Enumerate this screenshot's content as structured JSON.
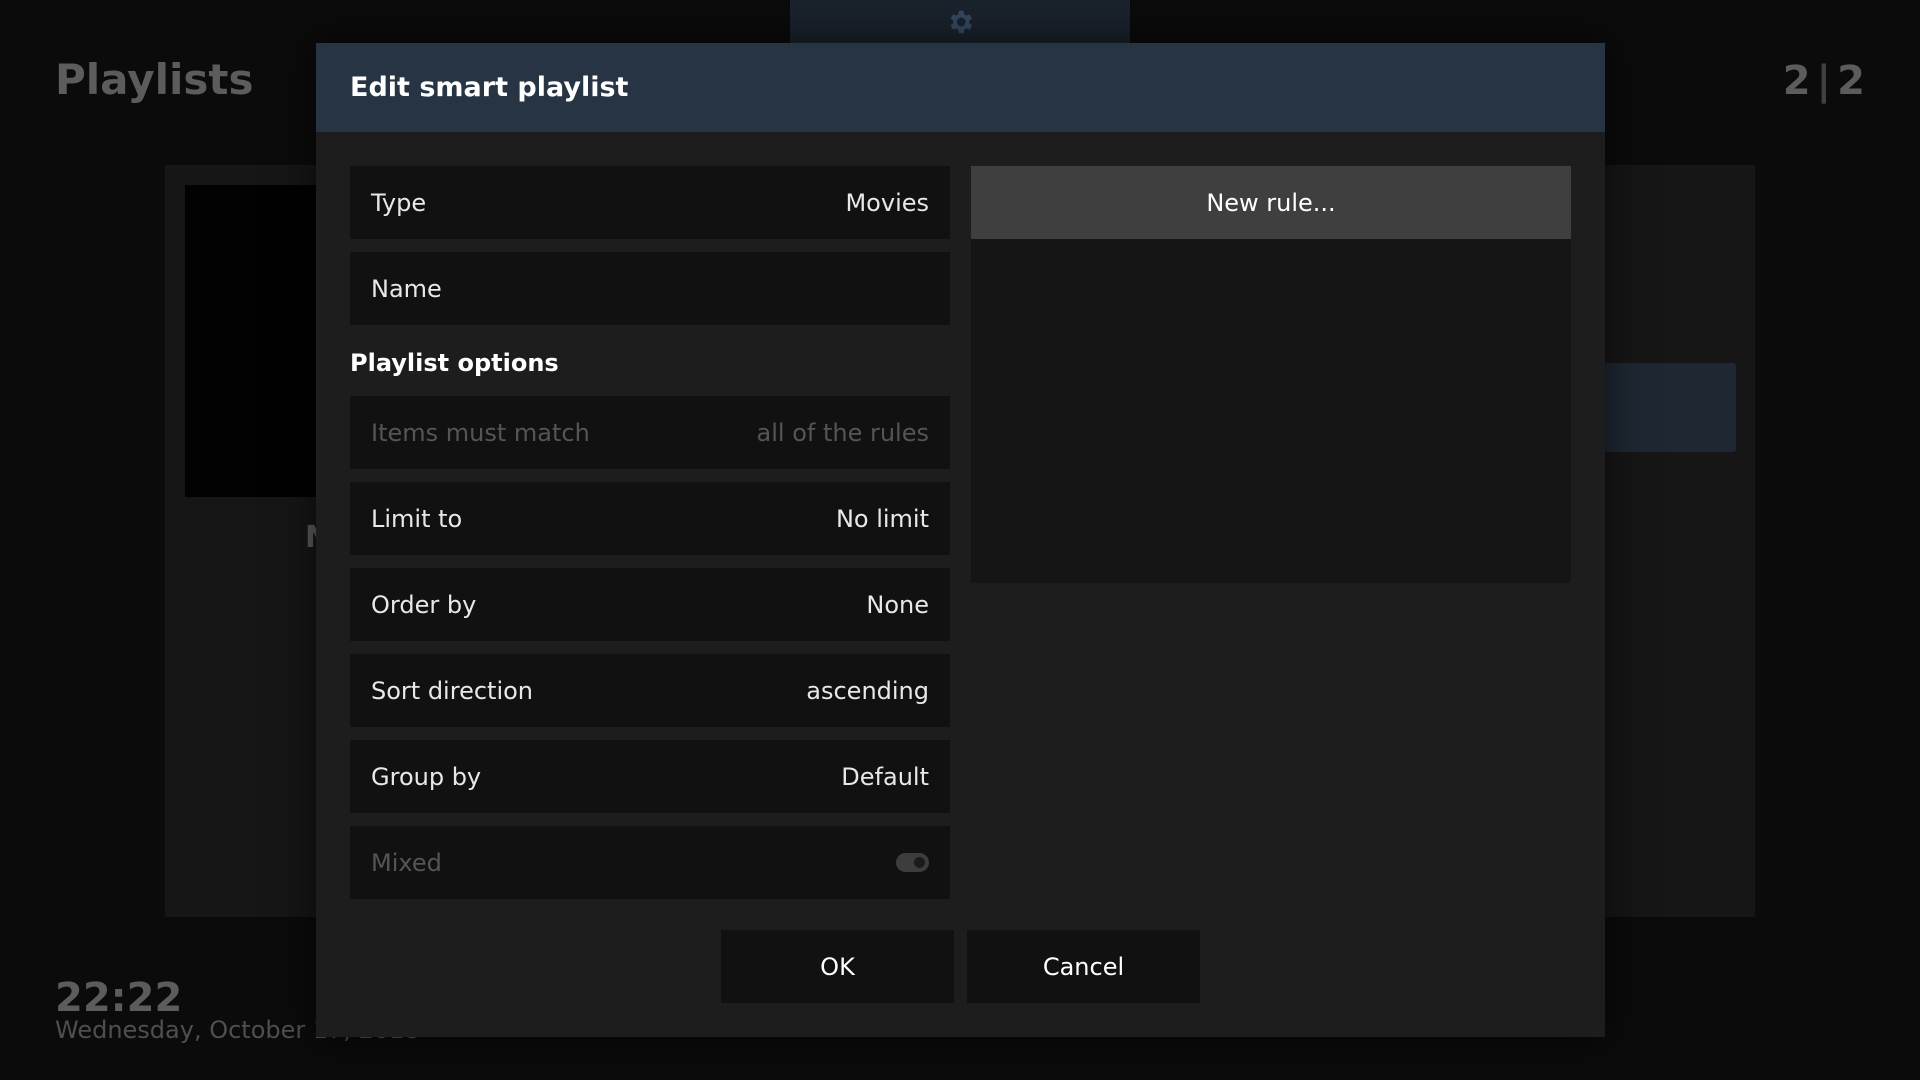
{
  "background": {
    "page_title": "Playlists",
    "page_counter_current": "2",
    "page_counter_separator": "|",
    "page_counter_total": "2",
    "partial_label": "N",
    "clock": "22:22",
    "date": "Wednesday, October 17, 2018",
    "top_tab_icon": "gear-icon"
  },
  "dialog": {
    "title": "Edit smart playlist",
    "header_color": "#263444",
    "rows": {
      "type": {
        "label": "Type",
        "value": "Movies"
      },
      "name": {
        "label": "Name",
        "value": ""
      }
    },
    "section_title": "Playlist options",
    "options": {
      "match": {
        "label": "Items must match",
        "value": "all of the rules",
        "enabled": false
      },
      "limit": {
        "label": "Limit to",
        "value": "No limit"
      },
      "order": {
        "label": "Order by",
        "value": "None"
      },
      "direction": {
        "label": "Sort direction",
        "value": "ascending"
      },
      "group": {
        "label": "Group by",
        "value": "Default"
      },
      "mixed": {
        "label": "Mixed",
        "toggle_on": false,
        "enabled": false
      }
    },
    "rules": {
      "new_rule_label": "New rule..."
    },
    "ok_label": "OK",
    "cancel_label": "Cancel"
  }
}
